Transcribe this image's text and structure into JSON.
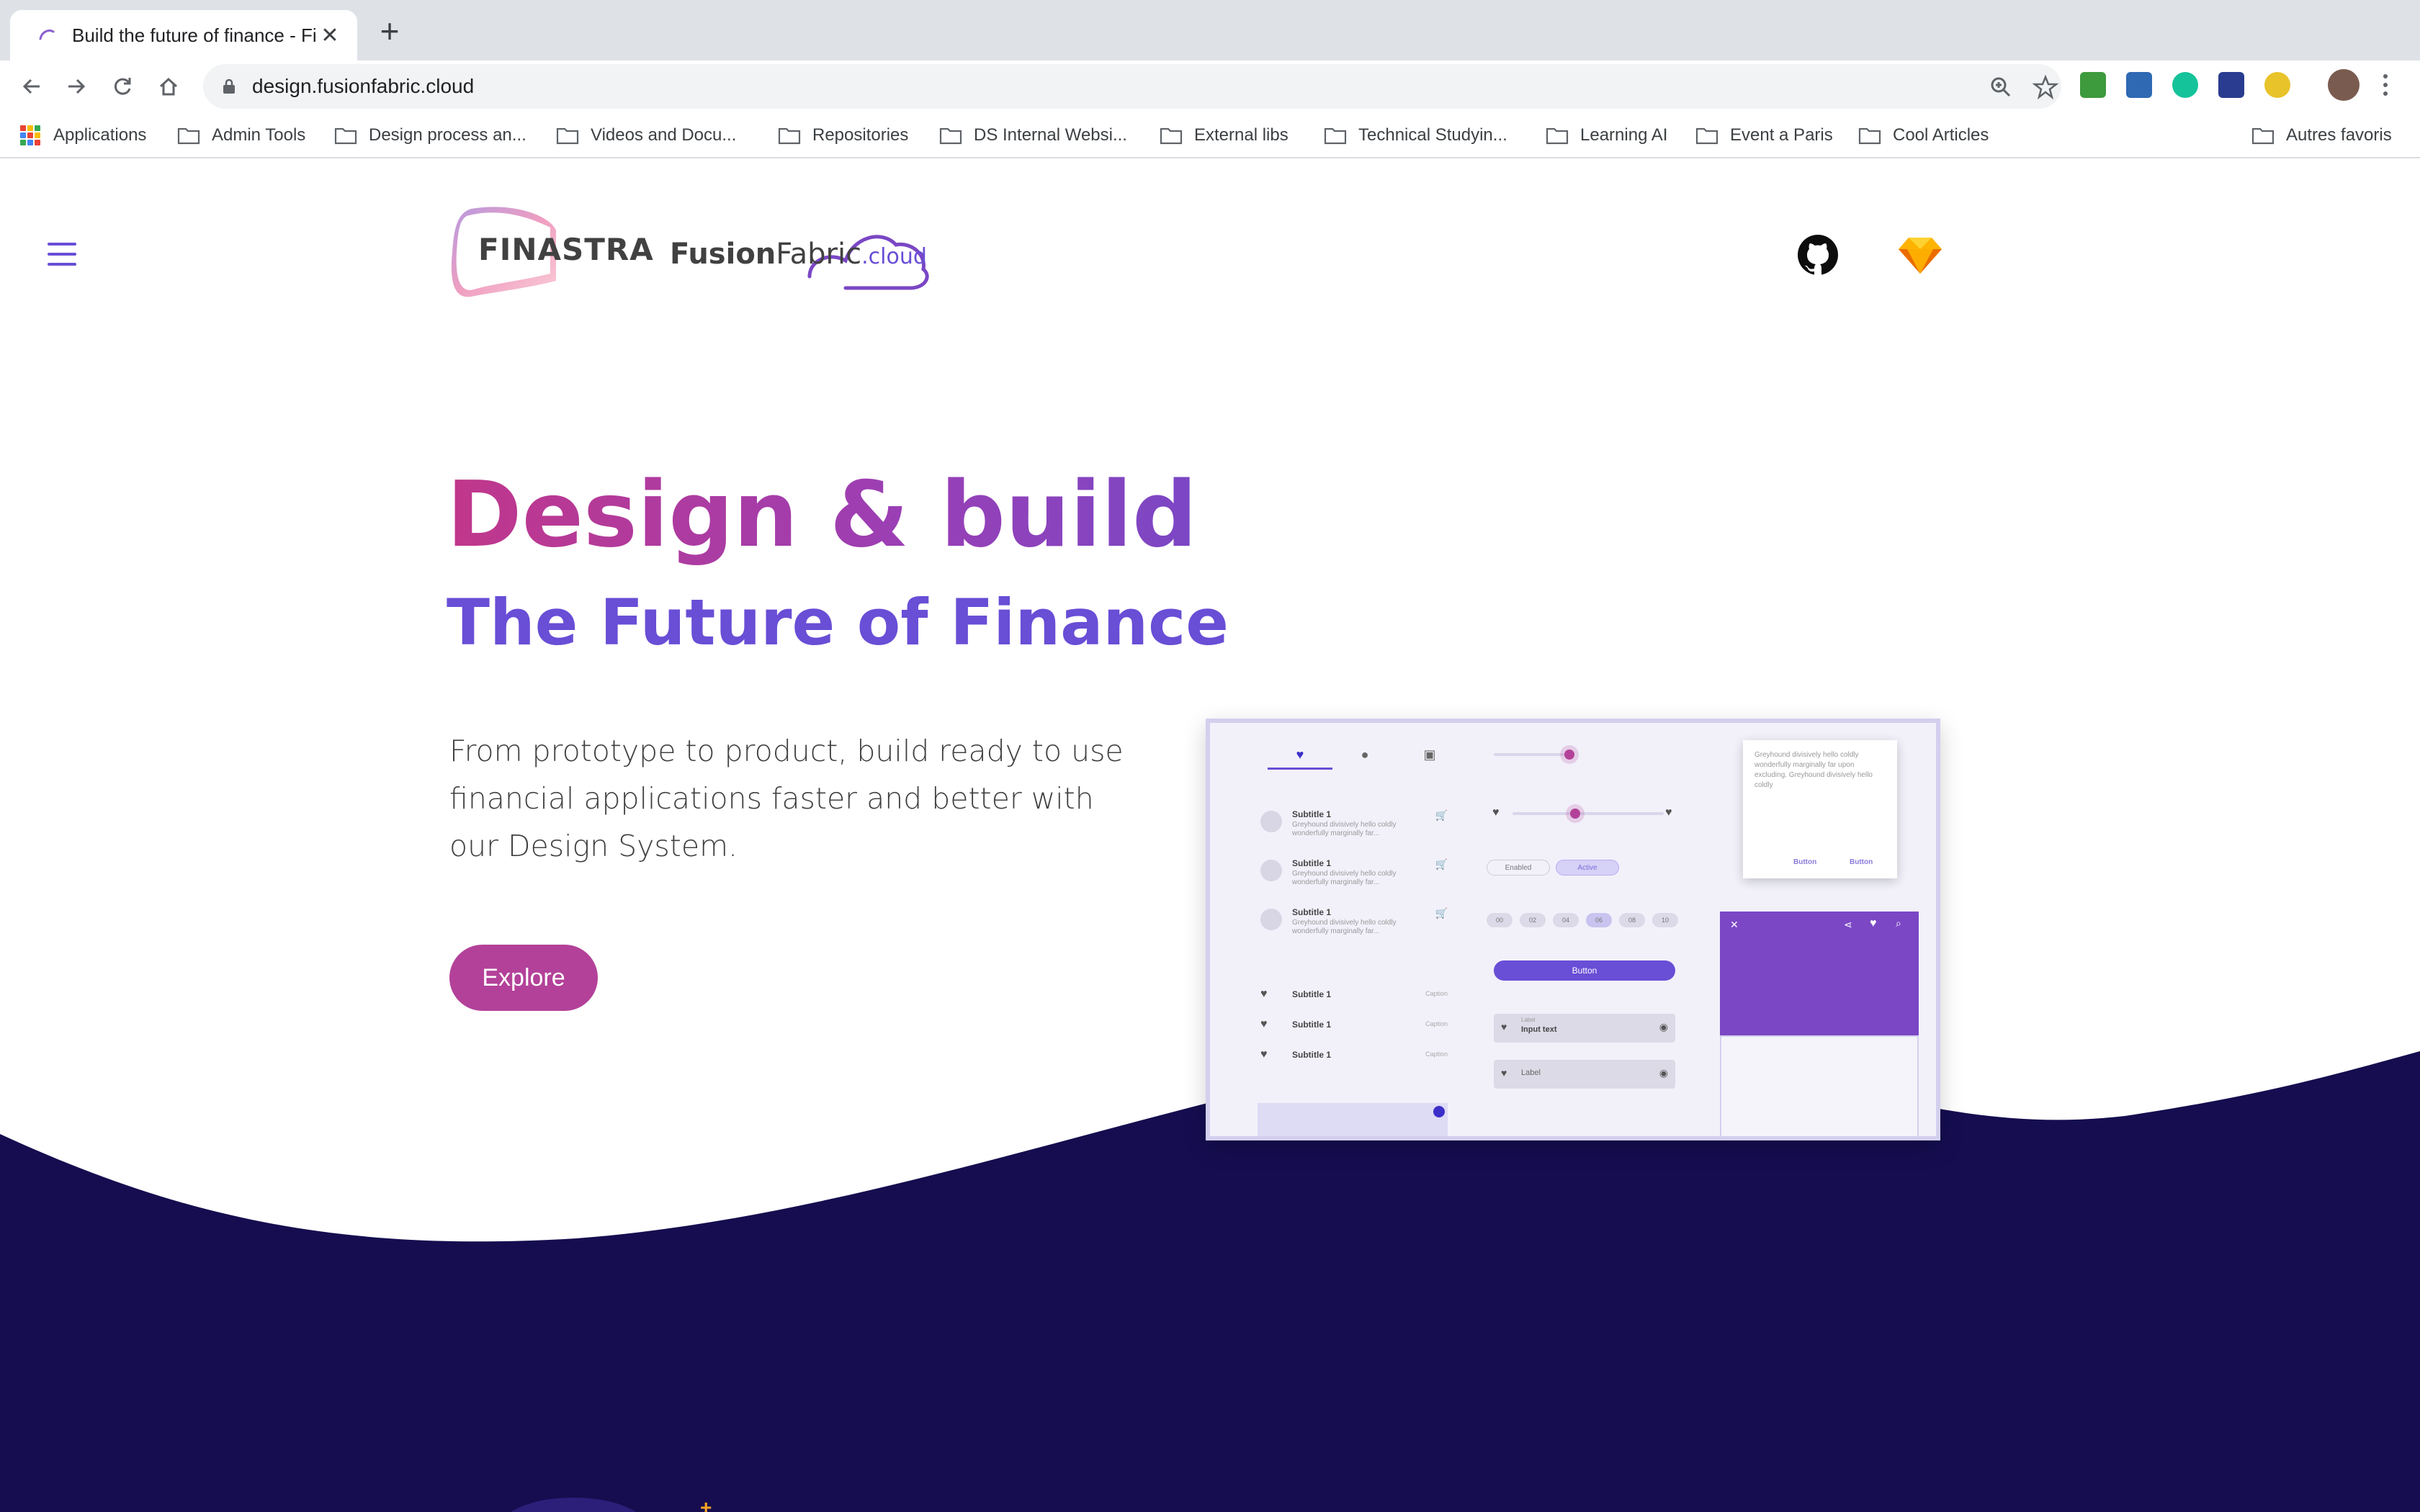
{
  "browser": {
    "tab_title": "Build the future of finance - Fin",
    "url": "design.fusionfabric.cloud",
    "new_tab_symbol": "+",
    "close_symbol": "✕",
    "bookmarks": [
      {
        "label": "Applications"
      },
      {
        "label": "Admin Tools"
      },
      {
        "label": "Design process an..."
      },
      {
        "label": "Videos and Docu..."
      },
      {
        "label": "Repositories"
      },
      {
        "label": "DS Internal Websi..."
      },
      {
        "label": "External libs"
      },
      {
        "label": "Technical Studyin..."
      },
      {
        "label": "Learning AI"
      },
      {
        "label": "Event a Paris"
      },
      {
        "label": "Cool Articles"
      }
    ],
    "other_bookmarks": "Autres favoris",
    "extensions": [
      "evernote-icon",
      "screenshot-icon",
      "grammarly-icon",
      "og-icon",
      "night-mode-icon"
    ]
  },
  "header": {
    "logo_finastra": "FINASTRA",
    "logo_fusion": "Fusion",
    "logo_fabric": "Fabric",
    "logo_cloud": ".cloud",
    "icons": [
      "menu-icon",
      "github-icon",
      "sketch-icon"
    ]
  },
  "hero": {
    "title": "Design & build",
    "subtitle": "The Future of Finance",
    "description": "From prototype to product, build ready to use financial applications faster and better with our Design System.",
    "cta": "Explore"
  },
  "mockup": {
    "list_items": [
      {
        "title": "Subtitle 1",
        "body": "Greyhound divisively hello coldly wonderfully marginally far..."
      },
      {
        "title": "Subtitle 1",
        "body": "Greyhound divisively hello coldly wonderfully marginally far..."
      },
      {
        "title": "Subtitle 1",
        "body": "Greyhound divisively hello coldly wonderfully marginally far..."
      }
    ],
    "rows": [
      {
        "title": "Subtitle 1",
        "caption": "Caption"
      },
      {
        "title": "Subtitle 1",
        "caption": "Caption"
      },
      {
        "title": "Subtitle 1",
        "caption": "Caption"
      }
    ],
    "chip_enabled": "Enabled",
    "chip_active": "Active",
    "pagination": [
      "00",
      "02",
      "04",
      "06",
      "08",
      "10"
    ],
    "button": "Button",
    "input_label": "Label",
    "input_value": "Input text",
    "input2_label": "Label",
    "card_text": "Greyhound divisively hello coldly wonderfully marginally far upon excluding. Greyhound divisively hello coldly",
    "card_btn1": "Button",
    "card_btn2": "Button",
    "appbar_close": "✕"
  },
  "colors": {
    "brand_purple": "#694ed6",
    "brand_pink": "#c1378b",
    "cta_bg": "#b34199",
    "dark_navy": "#150d4f"
  }
}
